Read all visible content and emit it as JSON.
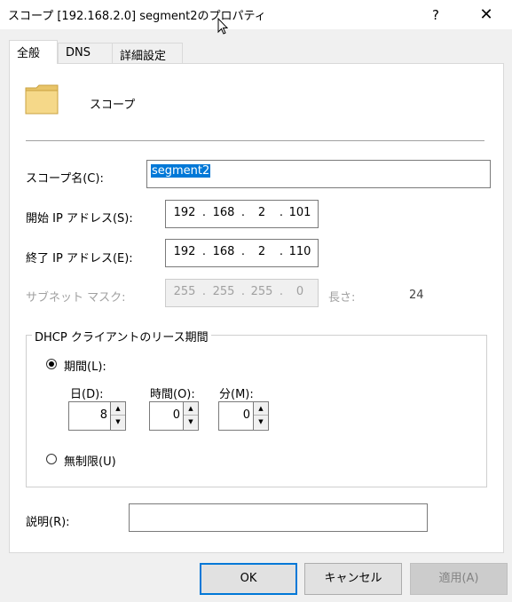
{
  "window": {
    "title": "スコープ [192.168.2.0] segment2のプロパティ",
    "help_label": "?",
    "close_label": "✕"
  },
  "tabs": [
    {
      "label": "全般"
    },
    {
      "label": "DNS"
    },
    {
      "label": "詳細設定"
    }
  ],
  "general": {
    "heading": "スコープ",
    "scope_name_label": "スコープ名(C):",
    "scope_name_value": "segment2",
    "start_ip_label": "開始 IP アドレス(S):",
    "start_ip": [
      "192",
      "168",
      "2",
      "101"
    ],
    "end_ip_label": "終了 IP アドレス(E):",
    "end_ip": [
      "192",
      "168",
      "2",
      "110"
    ],
    "subnet_label": "サブネット マスク:",
    "subnet_mask": [
      "255",
      "255",
      "255",
      "0"
    ],
    "length_label": "長さ:",
    "length_value": "24",
    "lease": {
      "group_title": "DHCP クライアントのリース期間",
      "limited_label": "期間(L):",
      "days_label": "日(D):",
      "days_value": "8",
      "hours_label": "時間(O):",
      "hours_value": "0",
      "minutes_label": "分(M):",
      "minutes_value": "0",
      "unlimited_label": "無制限(U)",
      "selected": "limited"
    },
    "description_label": "説明(R):",
    "description_value": ""
  },
  "buttons": {
    "ok": "OK",
    "cancel": "キャンセル",
    "apply": "適用(A)"
  },
  "colors": {
    "accent": "#0078d7",
    "panel": "#ffffff",
    "window": "#f0f0f0",
    "folder": "#f5d889"
  }
}
